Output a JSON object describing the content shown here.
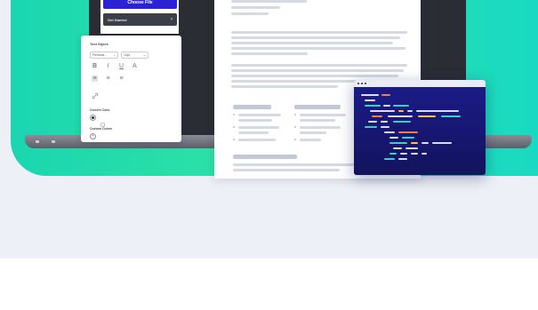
{
  "upload_panel": {
    "choose_file_label": "Choose File",
    "get_started_label": "Get Started",
    "get_started_arrow": "›"
  },
  "text_styles": {
    "title": "Text Styles",
    "font_select": "Persona...",
    "font_select_arrow": "⌄",
    "size_select": "12pt",
    "size_select_arrow": "⌄",
    "bold": "B",
    "italic": "I",
    "underline": "U",
    "text_color": "A",
    "align_left": "≡",
    "align_center": "≡",
    "align_right": "≡",
    "link_icon": "link-icon",
    "current_color_label": "Current Color",
    "custom_colors_label": "Custom Colors",
    "add_color": "+",
    "colors": {
      "current": "#1f2a5a",
      "accent": "#2b22d6"
    }
  },
  "theme": {
    "gradient_start": "#1ad6b0",
    "gradient_end": "#19d9c2",
    "code_bg": "#1b1b86"
  }
}
